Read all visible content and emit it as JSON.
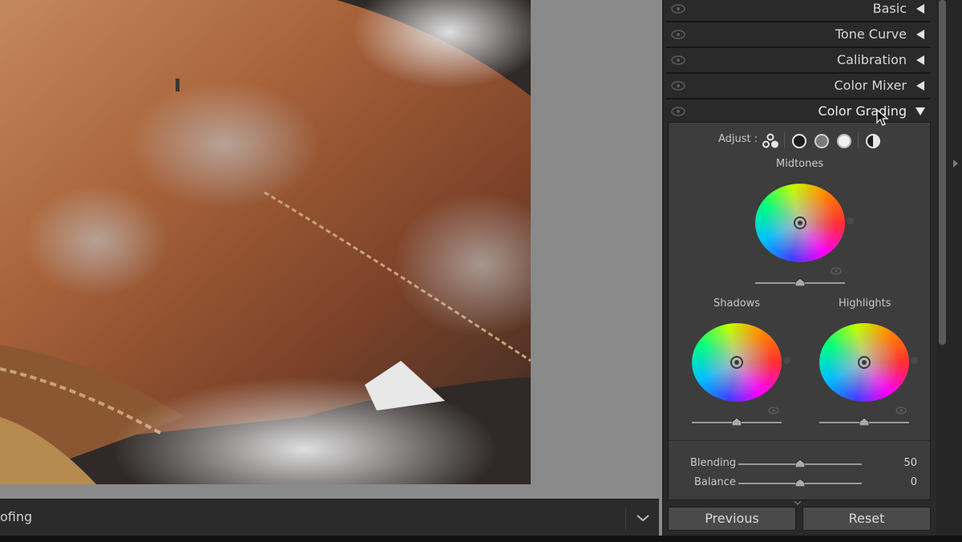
{
  "toolbar": {
    "label": "ofing"
  },
  "panels": [
    {
      "title": "Basic",
      "expanded": false
    },
    {
      "title": "Tone Curve",
      "expanded": false
    },
    {
      "title": "Calibration",
      "expanded": false
    },
    {
      "title": "Color Mixer",
      "expanded": false
    },
    {
      "title": "Color Grading",
      "expanded": true
    }
  ],
  "color_grading": {
    "adjust_label": "Adjust :",
    "adjust_modes": [
      "three-way-icon",
      "shadows-icon",
      "midtones-icon",
      "highlights-icon",
      "global-icon"
    ],
    "midtones_label": "Midtones",
    "shadows_label": "Shadows",
    "highlights_label": "Highlights",
    "midtones_luminance": 0.5,
    "shadows_luminance": 0.5,
    "highlights_luminance": 0.5,
    "blending": {
      "label": "Blending",
      "value": "50",
      "level": 0.5
    },
    "balance": {
      "label": "Balance",
      "value": "0",
      "level": 0.5
    }
  },
  "buttons": {
    "previous": "Previous",
    "reset": "Reset"
  },
  "colors": {
    "panel_bg": "#2a2a2a",
    "section_bg": "#3d3d3d",
    "canvas_bg": "#8c8c8c"
  }
}
